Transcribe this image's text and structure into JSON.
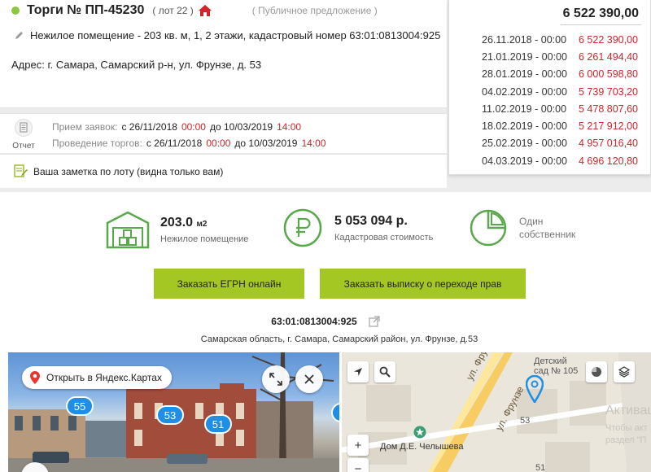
{
  "lot_header": {
    "title": "Торги № ПП-45230",
    "lot": "( лот 22 )",
    "offer_type": "( Публичное предложение )",
    "description": "Нежилое помещение - 203 кв. м, 1, 2 этажи, кадастровый номер 63:01:0813004:925",
    "address": "Адрес: г. Самара, Самарский р-н, ул. Фрунзе, д. 53"
  },
  "price_history": {
    "current_price": "6 522 390,00",
    "rows": [
      {
        "date": "26.11.2018 - 00:00",
        "price": "6 522 390,00"
      },
      {
        "date": "21.01.2019 - 00:00",
        "price": "6 261 494,40"
      },
      {
        "date": "28.01.2019 - 00:00",
        "price": "6 000 598,80"
      },
      {
        "date": "04.02.2019 - 00:00",
        "price": "5 739 703,20"
      },
      {
        "date": "11.02.2019 - 00:00",
        "price": "5 478 807,60"
      },
      {
        "date": "18.02.2019 - 00:00",
        "price": "5 217 912,00"
      },
      {
        "date": "25.02.2019 - 00:00",
        "price": "4 957 016,40"
      },
      {
        "date": "04.03.2019 - 00:00",
        "price": "4 696 120,80"
      }
    ]
  },
  "auction_dates": {
    "report_label": "Отчет",
    "applications": {
      "label": "Прием заявок:",
      "from": "с 26/11/2018",
      "from_time": "00:00",
      "to": "до 10/03/2019",
      "to_time": "14:00"
    },
    "bidding": {
      "label": "Проведение торгов:",
      "from": "с 26/11/2018",
      "from_time": "00:00",
      "to": "до 10/03/2019",
      "to_time": "14:00"
    }
  },
  "note": {
    "text": "Ваша заметка по лоту (видна только вам)"
  },
  "stats": {
    "area": {
      "value": "203.0",
      "unit": "м2",
      "label": "Нежилое помещение"
    },
    "cadastral_value": {
      "value": "5 053 094 р.",
      "label": "Кадастровая стоимость"
    },
    "owners": {
      "line1": "Один",
      "line2": "собственник"
    }
  },
  "buttons": {
    "order_egrn": "Заказать ЕГРН онлайн",
    "order_transfer": "Заказать выписку о переходе прав"
  },
  "cadastral": {
    "number": "63:01:0813004:925",
    "full_address": "Самарская область, г. Самара, Самарский район, ул. Фрунзе, д.53"
  },
  "street_view": {
    "open_yandex_label": "Открыть в Яндекс.Картах",
    "markers": [
      "55",
      "53",
      "51"
    ]
  },
  "map": {
    "kindergarten_line1": "Детский",
    "kindergarten_line2": "сад № 105",
    "street1": "ул. Фрунзе",
    "street2": "ул. Фрунзе",
    "house_label": "Дом Д.Е. Челышева",
    "number_53": "53",
    "number_51": "51",
    "zoom_in": "+",
    "zoom_out": "−",
    "watermark_title": "Активац",
    "watermark_line1": "Чтобы акт",
    "watermark_line2": "раздел \"П"
  },
  "colors": {
    "accent_green": "#a5c723",
    "status_green": "#8cc63f",
    "price_red": "#d0252b",
    "marker_blue": "#1e8ee6"
  }
}
